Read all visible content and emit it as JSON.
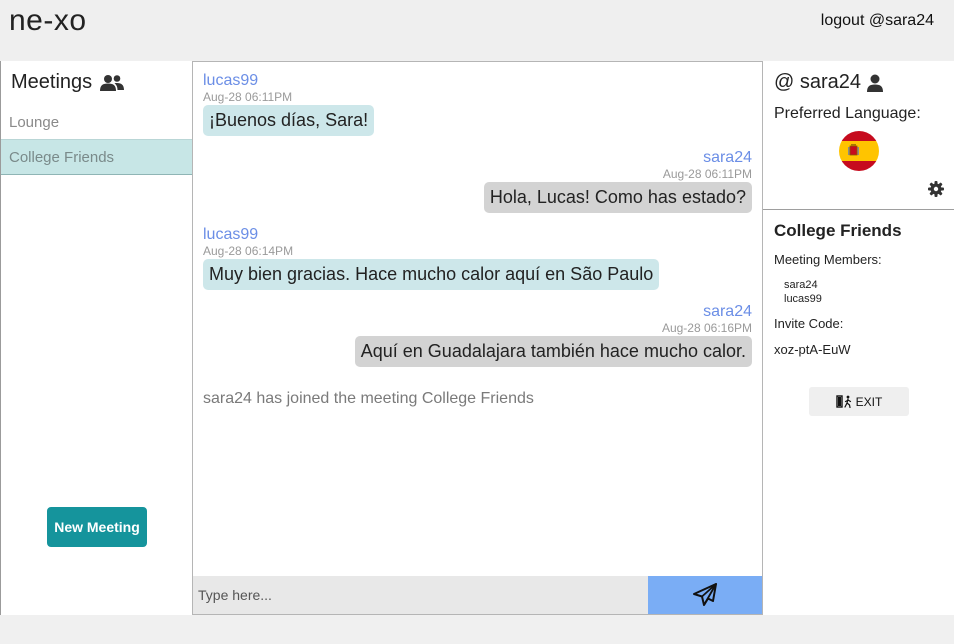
{
  "app": {
    "logo": "ne-xo",
    "logout_label": "logout @sara24"
  },
  "sidebar": {
    "title": "Meetings",
    "title_icon": "users-icon",
    "meetings": [
      {
        "label": "Lounge",
        "active": false
      },
      {
        "label": "College Friends",
        "active": true
      }
    ],
    "new_meeting_label": "New Meeting"
  },
  "chat": {
    "messages": [
      {
        "user": "lucas99",
        "time": "Aug-28 06:11PM",
        "text": "¡Buenos días, Sara!",
        "side": "left"
      },
      {
        "user": "sara24",
        "time": "Aug-28 06:11PM",
        "text": "Hola, Lucas! Como has estado?",
        "side": "right"
      },
      {
        "user": "lucas99",
        "time": "Aug-28 06:14PM",
        "text": "Muy bien gracias. Hace mucho calor aquí en São Paulo",
        "side": "left"
      },
      {
        "user": "sara24",
        "time": "Aug-28 06:16PM",
        "text": "Aquí en Guadalajara también hace mucho calor.",
        "side": "right"
      }
    ],
    "system_message": "sara24 has joined the meeting College Friends",
    "input_placeholder": "Type here...",
    "send_icon": "paper-plane-icon"
  },
  "profile": {
    "username": "@ sara24",
    "user_icon": "user-icon",
    "preferred_language_label": "Preferred Language:",
    "language_flag_icon": "spain-flag-icon",
    "settings_icon": "gear-icon"
  },
  "meeting_info": {
    "title": "College Friends",
    "members_label": "Meeting Members:",
    "members": [
      "sara24",
      "lucas99"
    ],
    "invite_label": "Invite Code:",
    "invite_code": "xoz-ptA-EuW",
    "exit_label": "EXIT",
    "exit_icon": "door-exit-icon"
  },
  "colors": {
    "accent_teal": "#15949c",
    "send_blue": "#7aadf5",
    "username_blue": "#6b8ee6",
    "incoming_bubble": "#cde7ea",
    "outgoing_bubble": "#d3d3d3",
    "active_meeting": "#c7e6e6"
  }
}
